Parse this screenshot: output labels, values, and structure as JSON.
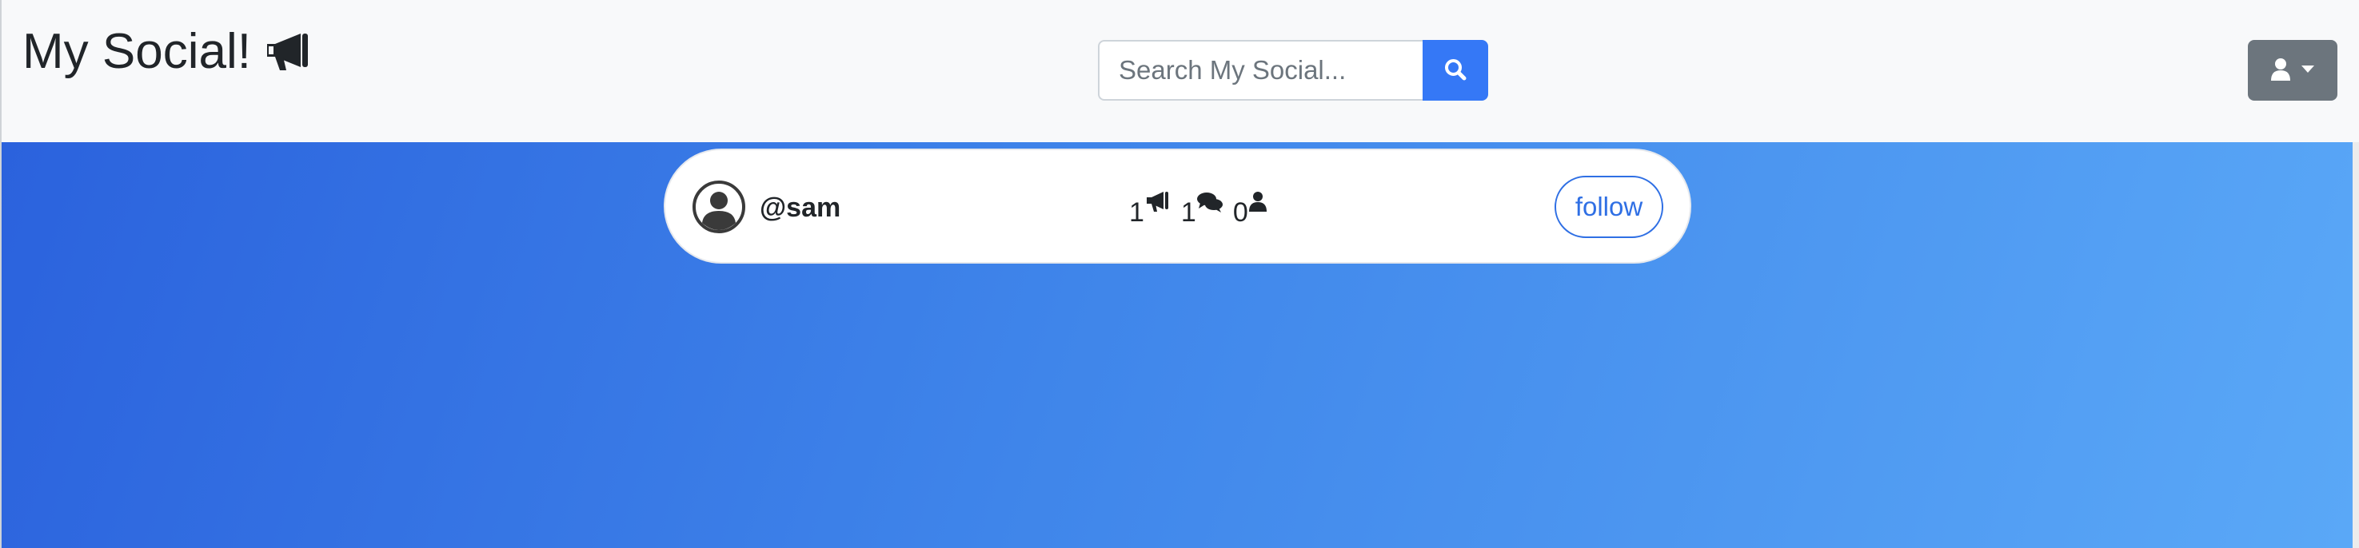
{
  "navbar": {
    "brand": "My Social!",
    "brand_icon": "megaphone-icon",
    "search": {
      "placeholder": "Search My Social...",
      "value": "",
      "button_icon": "search-icon"
    },
    "user_menu_icons": [
      "user-icon",
      "caret-down-icon"
    ]
  },
  "main": {
    "background_colors": [
      "#2b62dd",
      "#5aa8f7"
    ],
    "user_card": {
      "avatar_icon": "user-circle-icon",
      "username": "@sam",
      "stats": [
        {
          "name": "posts",
          "value": "1",
          "icon": "megaphone-icon"
        },
        {
          "name": "comments",
          "value": "1",
          "icon": "comments-icon"
        },
        {
          "name": "followers",
          "value": "0",
          "icon": "user-icon"
        }
      ],
      "follow_label": "follow"
    }
  },
  "colors": {
    "primary": "#3578f6",
    "secondary": "#6c757d",
    "navbar_bg": "#f8f9fa"
  }
}
